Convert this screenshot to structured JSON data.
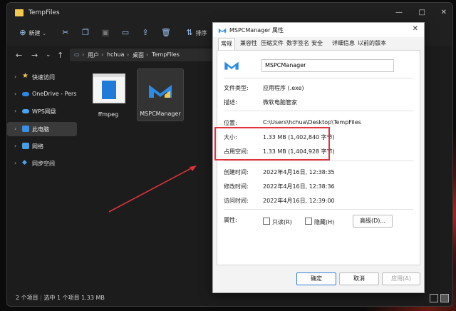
{
  "explorer": {
    "title": "TempFiles",
    "toolbar": {
      "new_label": "新建",
      "sort_label": "排序"
    },
    "path": [
      "用户",
      "hchua",
      "桌面",
      "TempFiles"
    ],
    "sidebar": [
      {
        "label": "快速访问",
        "icon": "star-icon"
      },
      {
        "label": "OneDrive - Personal",
        "icon": "cloud-icon"
      },
      {
        "label": "WPS网盘",
        "icon": "cloud-icon"
      },
      {
        "label": "此电脑",
        "icon": "computer-icon"
      },
      {
        "label": "网络",
        "icon": "network-icon"
      },
      {
        "label": "同步空间",
        "icon": "sync-icon"
      }
    ],
    "files": [
      {
        "name": "ffmpeg"
      },
      {
        "name": "MSPCManager"
      }
    ],
    "status": {
      "count": "2 个项目",
      "selected": "选中 1 个项目  1.33 MB"
    }
  },
  "dialog": {
    "title": "MSPCManager 属性",
    "tabs": [
      "常规",
      "兼容性",
      "压缩文件",
      "数字签名",
      "安全",
      "详细信息",
      "以前的版本"
    ],
    "name_value": "MSPCManager",
    "fields": {
      "type_label": "文件类型:",
      "type_value": "应用程序 (.exe)",
      "desc_label": "描述:",
      "desc_value": "微软电脑管家",
      "loc_label": "位置:",
      "loc_value": "C:\\Users\\hchua\\Desktop\\TempFiles",
      "size_label": "大小:",
      "size_value": "1.33 MB (1,402,840 字节)",
      "disk_label": "占用空间:",
      "disk_value": "1.33 MB (1,404,928 字节)",
      "created_label": "创建时间:",
      "created_value": "2022年4月16日, 12:38:35",
      "modified_label": "修改时间:",
      "modified_value": "2022年4月16日, 12:38:36",
      "accessed_label": "访问时间:",
      "accessed_value": "2022年4月16日, 12:39:00",
      "attr_label": "属性:",
      "readonly_label": "只读(R)",
      "hidden_label": "隐藏(H)",
      "advanced_label": "高级(D)..."
    },
    "buttons": {
      "ok": "确定",
      "cancel": "取消",
      "apply": "应用(A)"
    }
  },
  "colors": {
    "highlight": "#e0333f",
    "accent": "#2f7fd6"
  }
}
